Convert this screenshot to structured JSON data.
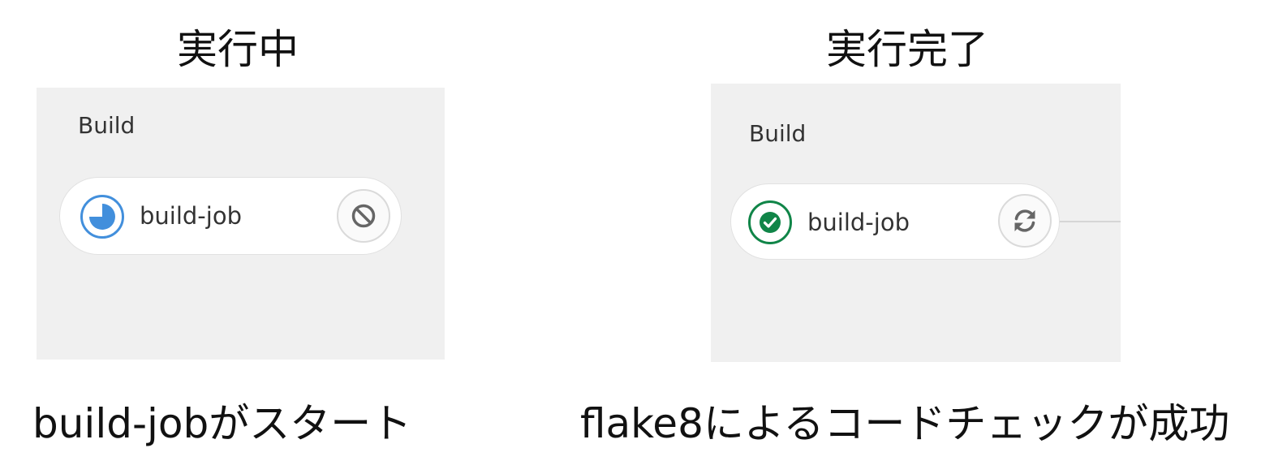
{
  "panels": {
    "running": {
      "heading": "実行中",
      "stage_title": "Build",
      "job_name": "build-job",
      "status_icon": "status-running-icon",
      "action_icon": "cancel-icon",
      "caption": "build-jobがスタート"
    },
    "finished": {
      "heading": "実行完了",
      "stage_title": "Build",
      "job_name": "build-job",
      "status_icon": "status-success-icon",
      "action_icon": "retry-icon",
      "caption": "flake8によるコードチェックが成功"
    }
  },
  "colors": {
    "running_blue": "#428fdc",
    "success_green": "#108548",
    "panel_bg": "#f0f0f0",
    "icon_gray": "#666666"
  }
}
